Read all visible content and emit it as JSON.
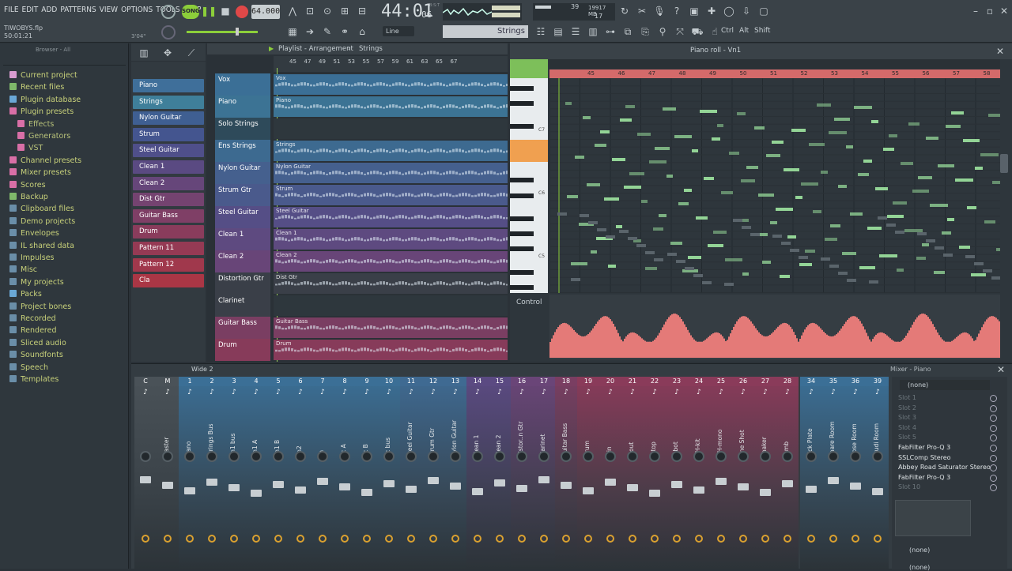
{
  "menu": [
    "FILE",
    "EDIT",
    "ADD",
    "PATTERNS",
    "VIEW",
    "OPTIONS",
    "TOOLS",
    "HELP"
  ],
  "project": {
    "file": "TIWOBYS.flp",
    "time": "50:01:21"
  },
  "transport": {
    "mode": "SONG",
    "tempo": "64.000",
    "position": "44:01",
    "ticks": "06",
    "bst": "B:S:T",
    "cpu": "39",
    "mem": "19917 MB",
    "poly": "17",
    "snap": "Line",
    "hint": "Strings",
    "misc": "3'04\""
  },
  "shortcut_labels": [
    "Ctrl",
    "Alt",
    "Shift"
  ],
  "browser": {
    "title": "Browser - All",
    "items": [
      {
        "label": "Current project",
        "color": "#d89bd0",
        "sub": false
      },
      {
        "label": "Recent files",
        "color": "#7fb86a",
        "sub": false
      },
      {
        "label": "Plugin database",
        "color": "#6aa8d6",
        "sub": false
      },
      {
        "label": "Plugin presets",
        "color": "#d86fa6",
        "sub": false
      },
      {
        "label": "Effects",
        "color": "#d86fa6",
        "sub": true
      },
      {
        "label": "Generators",
        "color": "#d86fa6",
        "sub": true
      },
      {
        "label": "VST",
        "color": "#d86fa6",
        "sub": true
      },
      {
        "label": "Channel presets",
        "color": "#d86fa6",
        "sub": false
      },
      {
        "label": "Mixer presets",
        "color": "#d86fa6",
        "sub": false
      },
      {
        "label": "Scores",
        "color": "#d86fa6",
        "sub": false
      },
      {
        "label": "Backup",
        "color": "#7fb86a",
        "sub": false
      },
      {
        "label": "Clipboard files",
        "color": "#6a8ea8",
        "sub": false
      },
      {
        "label": "Demo projects",
        "color": "#6a8ea8",
        "sub": false
      },
      {
        "label": "Envelopes",
        "color": "#6a8ea8",
        "sub": false
      },
      {
        "label": "IL shared data",
        "color": "#6a8ea8",
        "sub": false
      },
      {
        "label": "Impulses",
        "color": "#6a8ea8",
        "sub": false
      },
      {
        "label": "Misc",
        "color": "#6a8ea8",
        "sub": false
      },
      {
        "label": "My projects",
        "color": "#6a8ea8",
        "sub": false
      },
      {
        "label": "Packs",
        "color": "#6aa8d6",
        "sub": false
      },
      {
        "label": "Project bones",
        "color": "#6a8ea8",
        "sub": false
      },
      {
        "label": "Recorded",
        "color": "#6a8ea8",
        "sub": false
      },
      {
        "label": "Rendered",
        "color": "#6a8ea8",
        "sub": false
      },
      {
        "label": "Sliced audio",
        "color": "#6a8ea8",
        "sub": false
      },
      {
        "label": "Soundfonts",
        "color": "#6a8ea8",
        "sub": false
      },
      {
        "label": "Speech",
        "color": "#6a8ea8",
        "sub": false
      },
      {
        "label": "Templates",
        "color": "#6a8ea8",
        "sub": false
      }
    ]
  },
  "channels": [
    {
      "name": "Piano",
      "color": "#3f6f9a"
    },
    {
      "name": "Strings",
      "color": "#3f7f9a"
    },
    {
      "name": "Nylon Guitar",
      "color": "#3f5f92"
    },
    {
      "name": "Strum",
      "color": "#44558f"
    },
    {
      "name": "Steel Guitar",
      "color": "#4f4f8a"
    },
    {
      "name": "Clean 1",
      "color": "#5a4a82"
    },
    {
      "name": "Clean 2",
      "color": "#66467a"
    },
    {
      "name": "Dist Gtr",
      "color": "#744370"
    },
    {
      "name": "Guitar Bass",
      "color": "#7f3f66"
    },
    {
      "name": "Drum",
      "color": "#8a3c5c"
    },
    {
      "name": "Pattern 11",
      "color": "#953a54"
    },
    {
      "name": "Pattern 12",
      "color": "#a0384c"
    },
    {
      "name": "Cla",
      "color": "#aa3645"
    }
  ],
  "playlist": {
    "title": "Playlist - Arrangement",
    "pattern": "Strings",
    "bars": [
      "45",
      "47",
      "49",
      "51",
      "53",
      "55",
      "57",
      "59",
      "61",
      "63",
      "65",
      "67"
    ],
    "tracks": [
      {
        "name": "Vox",
        "clip": "Vox",
        "color": "#3b6f96"
      },
      {
        "name": "Piano",
        "clip": "Piano",
        "color": "#3c7394"
      },
      {
        "name": "Solo Strings",
        "clip": "",
        "color": "#2e4a5a"
      },
      {
        "name": "Ens Strings",
        "clip": "Strings",
        "color": "#3d6a90"
      },
      {
        "name": "Nylon Guitar",
        "clip": "Nylon Guitar",
        "color": "#45608e"
      },
      {
        "name": "Strum Gtr",
        "clip": "Strum",
        "color": "#4a5a8c"
      },
      {
        "name": "Steel Guitar",
        "clip": "Steel Guitar",
        "color": "#554e86"
      },
      {
        "name": "Clean 1",
        "clip": "Clean 1",
        "color": "#5e4a80"
      },
      {
        "name": "Clean 2",
        "clip": "Clean 2",
        "color": "#684578"
      },
      {
        "name": "Distortion Gtr",
        "clip": "Dist Gtr",
        "color": "#3a3f48"
      },
      {
        "name": "Clarinet",
        "clip": "",
        "color": "#3a3f48"
      },
      {
        "name": "Guitar Bass",
        "clip": "Guitar Bass",
        "color": "#7a3e62"
      },
      {
        "name": "Drum",
        "clip": "Drum",
        "color": "#873b5a"
      }
    ]
  },
  "pianoroll": {
    "title": "Piano roll - Vn1",
    "bars": [
      "45",
      "46",
      "47",
      "48",
      "49",
      "50",
      "51",
      "52",
      "53",
      "54",
      "55",
      "56",
      "57",
      "58"
    ],
    "keys": [
      "C7",
      "C6",
      "C5"
    ],
    "control": "Control"
  },
  "mixer": {
    "title": "Mixer - Piano",
    "wide": "Wide 2",
    "strips": [
      {
        "n": "C",
        "label": "",
        "c": "#4a5258"
      },
      {
        "n": "M",
        "label": "Master",
        "c": "#4a5258"
      },
      {
        "n": "1",
        "label": "Piano",
        "c": "#3b6f96"
      },
      {
        "n": "2",
        "label": "Strings Bus",
        "c": "#3b6f96"
      },
      {
        "n": "3",
        "label": "Vn1 bus",
        "c": "#3b6f96"
      },
      {
        "n": "4",
        "label": "Vn1 A",
        "c": "#3b6f96"
      },
      {
        "n": "5",
        "label": "Vn1 B",
        "c": "#3b6f96"
      },
      {
        "n": "6",
        "label": "Vn2",
        "c": "#3b6f96"
      },
      {
        "n": "7",
        "label": "Va",
        "c": "#3b6f96"
      },
      {
        "n": "8",
        "label": "Vc A",
        "c": "#3b6f96"
      },
      {
        "n": "9",
        "label": "Vc B",
        "c": "#3b6f96"
      },
      {
        "n": "10",
        "label": "Vc bus",
        "c": "#3b6f96"
      },
      {
        "n": "11",
        "label": "Steel Guitar",
        "c": "#3f6a92"
      },
      {
        "n": "12",
        "label": "Strum Gtr",
        "c": "#3f6a92"
      },
      {
        "n": "13",
        "label": "Nylon Guitar",
        "c": "#3f6a92"
      },
      {
        "n": "14",
        "label": "Clean 1",
        "c": "#5b4a82"
      },
      {
        "n": "15",
        "label": "Clean 2",
        "c": "#5b4a82"
      },
      {
        "n": "16",
        "label": "Distor..n Gtr",
        "c": "#6a4578"
      },
      {
        "n": "17",
        "label": "Clarinet",
        "c": "#6a4578"
      },
      {
        "n": "18",
        "label": "Guitar Bass",
        "c": "#7a3e62"
      },
      {
        "n": "19",
        "label": "Drum",
        "c": "#8a3b5a"
      },
      {
        "n": "20",
        "label": "K-in",
        "c": "#8a3b5a"
      },
      {
        "n": "21",
        "label": "K-out",
        "c": "#8a3b5a"
      },
      {
        "n": "22",
        "label": "S-top",
        "c": "#8a3b5a"
      },
      {
        "n": "23",
        "label": "S-bot",
        "c": "#8a3b5a"
      },
      {
        "n": "24",
        "label": "OH-kit",
        "c": "#8a3b5a"
      },
      {
        "n": "25",
        "label": "OH-mono",
        "c": "#8a3b5a"
      },
      {
        "n": "26",
        "label": "One Shot",
        "c": "#8a3b5a"
      },
      {
        "n": "27",
        "label": "Shaker",
        "c": "#8a3b5a"
      },
      {
        "n": "28",
        "label": "Tamb",
        "c": "#8a3b5a"
      },
      {
        "n": "34",
        "label": "Kick Plate",
        "c": "#3b6f96"
      },
      {
        "n": "35",
        "label": "Snare Room",
        "c": "#3b6f96"
      },
      {
        "n": "36",
        "label": "Dose Room",
        "c": "#3b6f96"
      },
      {
        "n": "39",
        "label": "Studi Room",
        "c": "#3b6f96"
      }
    ],
    "input": "(none)",
    "slots": [
      "Slot 1",
      "Slot 2",
      "Slot 3",
      "Slot 4",
      "Slot 5",
      "FabFilter Pro-Q 3",
      "SSLComp Stereo",
      "Abbey Road Saturator Stereo",
      "FabFilter Pro-Q 3",
      "Slot 10"
    ],
    "output": "(none)",
    "output2": "(none)"
  }
}
